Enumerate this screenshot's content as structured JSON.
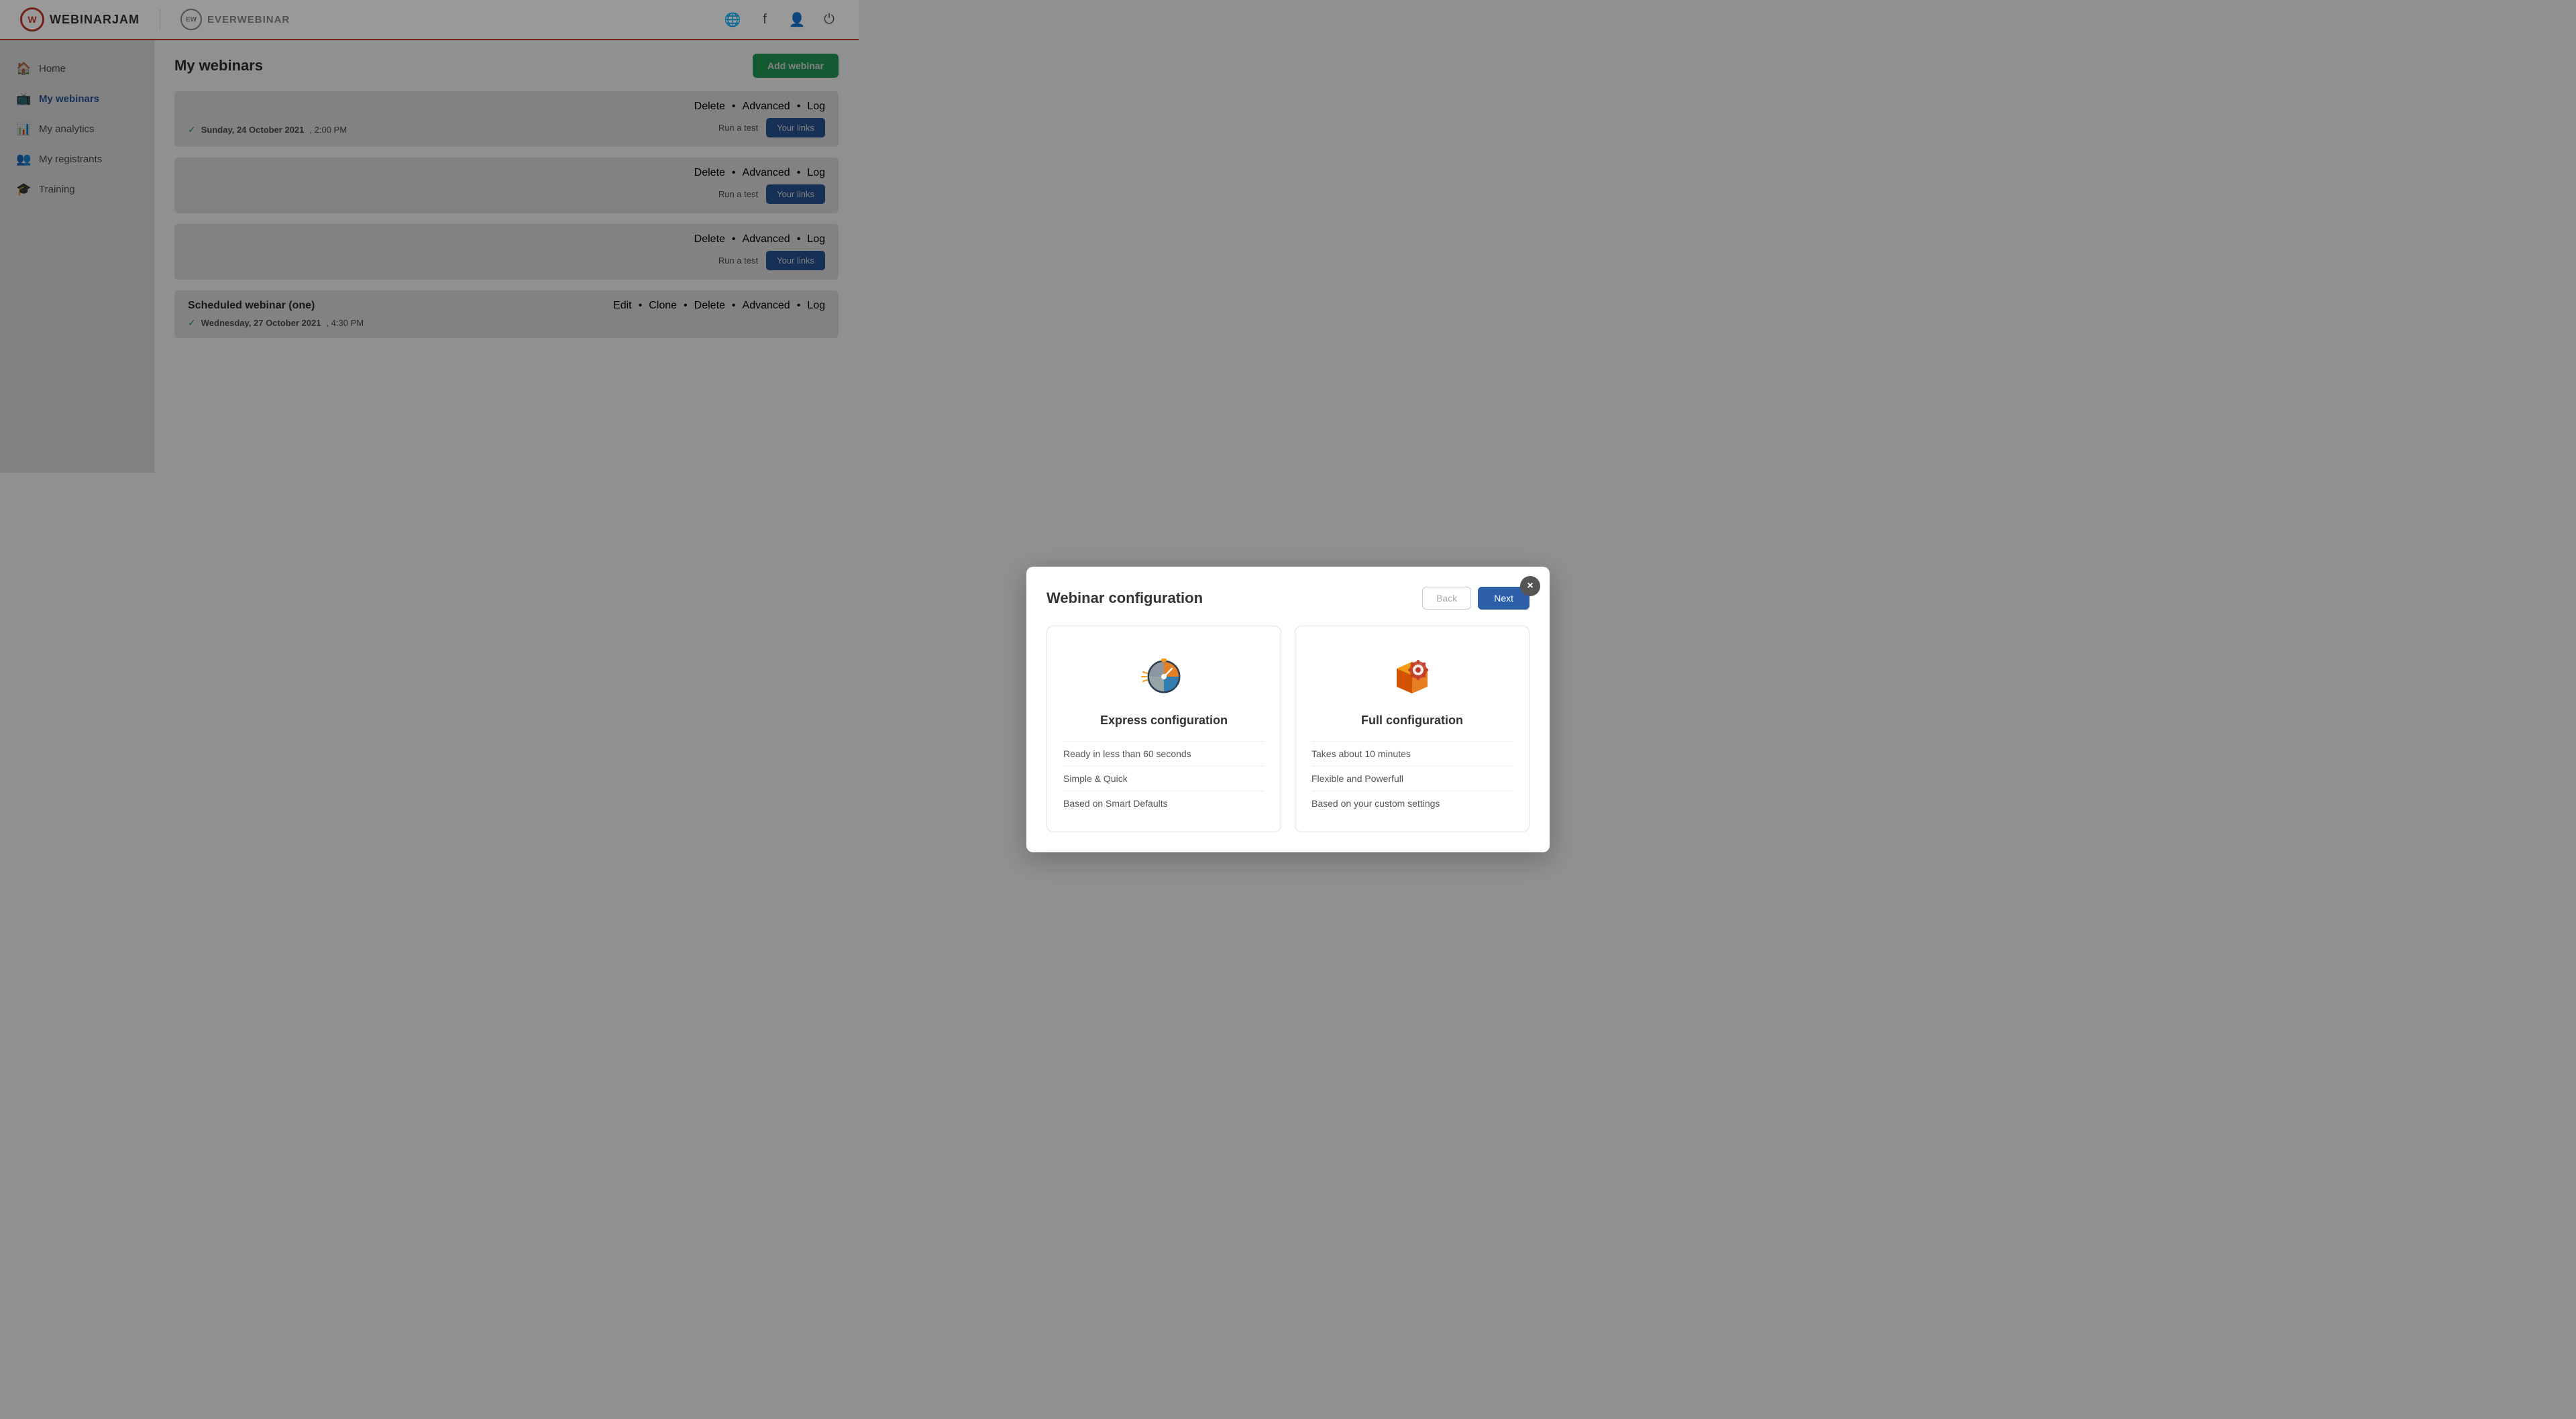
{
  "header": {
    "logo_wj_text": "WEBINARJAM",
    "logo_wj_letter": "W",
    "logo_ew_text": "EVERWEBINAR",
    "logo_ew_letter": "EW"
  },
  "sidebar": {
    "items": [
      {
        "id": "home",
        "label": "Home",
        "icon": "🏠",
        "active": false
      },
      {
        "id": "my-webinars",
        "label": "My webinars",
        "icon": "📺",
        "active": true
      },
      {
        "id": "my-analytics",
        "label": "My analytics",
        "icon": "📊",
        "active": false
      },
      {
        "id": "my-registrants",
        "label": "My registrants",
        "icon": "👥",
        "active": false
      },
      {
        "id": "training",
        "label": "Training",
        "icon": "🎓",
        "active": false
      }
    ]
  },
  "main": {
    "page_title": "My webinars",
    "add_webinar_label": "Add webinar",
    "webinar_sections": [
      {
        "id": "section1",
        "date": "Sunday, 24 October 2021, 2:00 PM",
        "run_test": "Run a test",
        "your_links": "Your links",
        "actions": [
          "Delete",
          "Advanced",
          "Log"
        ]
      },
      {
        "id": "section2",
        "date": "",
        "run_test": "Run a test",
        "your_links": "Your links",
        "actions": [
          "Delete",
          "Advanced",
          "Log"
        ]
      },
      {
        "id": "section3",
        "date": "",
        "run_test": "Run a test",
        "your_links": "Your links",
        "actions": [
          "Delete",
          "Advanced",
          "Log"
        ]
      }
    ],
    "scheduled_sections": [
      {
        "title": "Scheduled webinar (one)",
        "date": "Wednesday, 27 October 2021, 4:30 PM",
        "actions": [
          "Edit",
          "Clone",
          "Delete",
          "Advanced",
          "Log"
        ]
      }
    ]
  },
  "modal": {
    "title": "Webinar configuration",
    "close_label": "×",
    "back_label": "Back",
    "next_label": "Next",
    "express": {
      "title": "Express configuration",
      "features": [
        "Ready in less than 60 seconds",
        "Simple & Quick",
        "Based on Smart Defaults"
      ]
    },
    "full": {
      "title": "Full configuration",
      "features": [
        "Takes about 10 minutes",
        "Flexible and Powerfull",
        "Based on your custom settings"
      ]
    }
  }
}
